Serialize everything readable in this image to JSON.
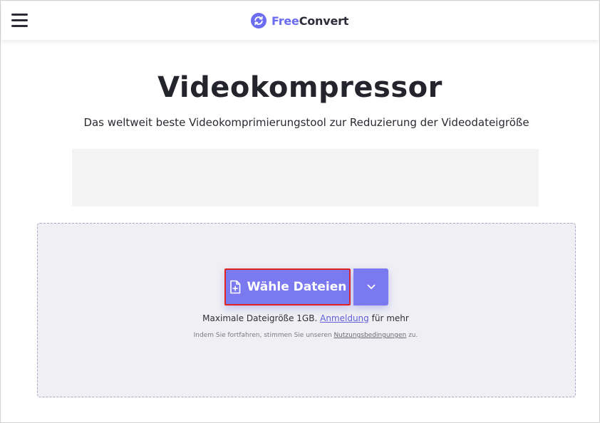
{
  "header": {
    "brand_free": "Free",
    "brand_convert": "Convert",
    "menu_icon": "hamburger-menu-icon",
    "logo_icon": "refresh-circle-icon"
  },
  "main": {
    "title": "Videokompressor",
    "subtitle": "Das weltweit beste Videokomprimierungstool zur Reduzierung der Videodateigröße"
  },
  "upload": {
    "choose_label": "Wähle Dateien",
    "choose_icon": "file-plus-icon",
    "dropdown_icon": "chevron-down-icon",
    "limit_prefix": "Maximale Dateigröße 1GB.",
    "limit_link": "Anmeldung",
    "limit_suffix": "für mehr",
    "terms_prefix": "Indem Sie fortfahren, stimmen Sie unseren",
    "terms_link": "Nutzungsbedingungen",
    "terms_suffix": "zu."
  },
  "colors": {
    "accent": "#7b79f0",
    "highlight_border": "#e02424",
    "brand_free": "#6c6cf0",
    "text_dark": "#24242c"
  }
}
